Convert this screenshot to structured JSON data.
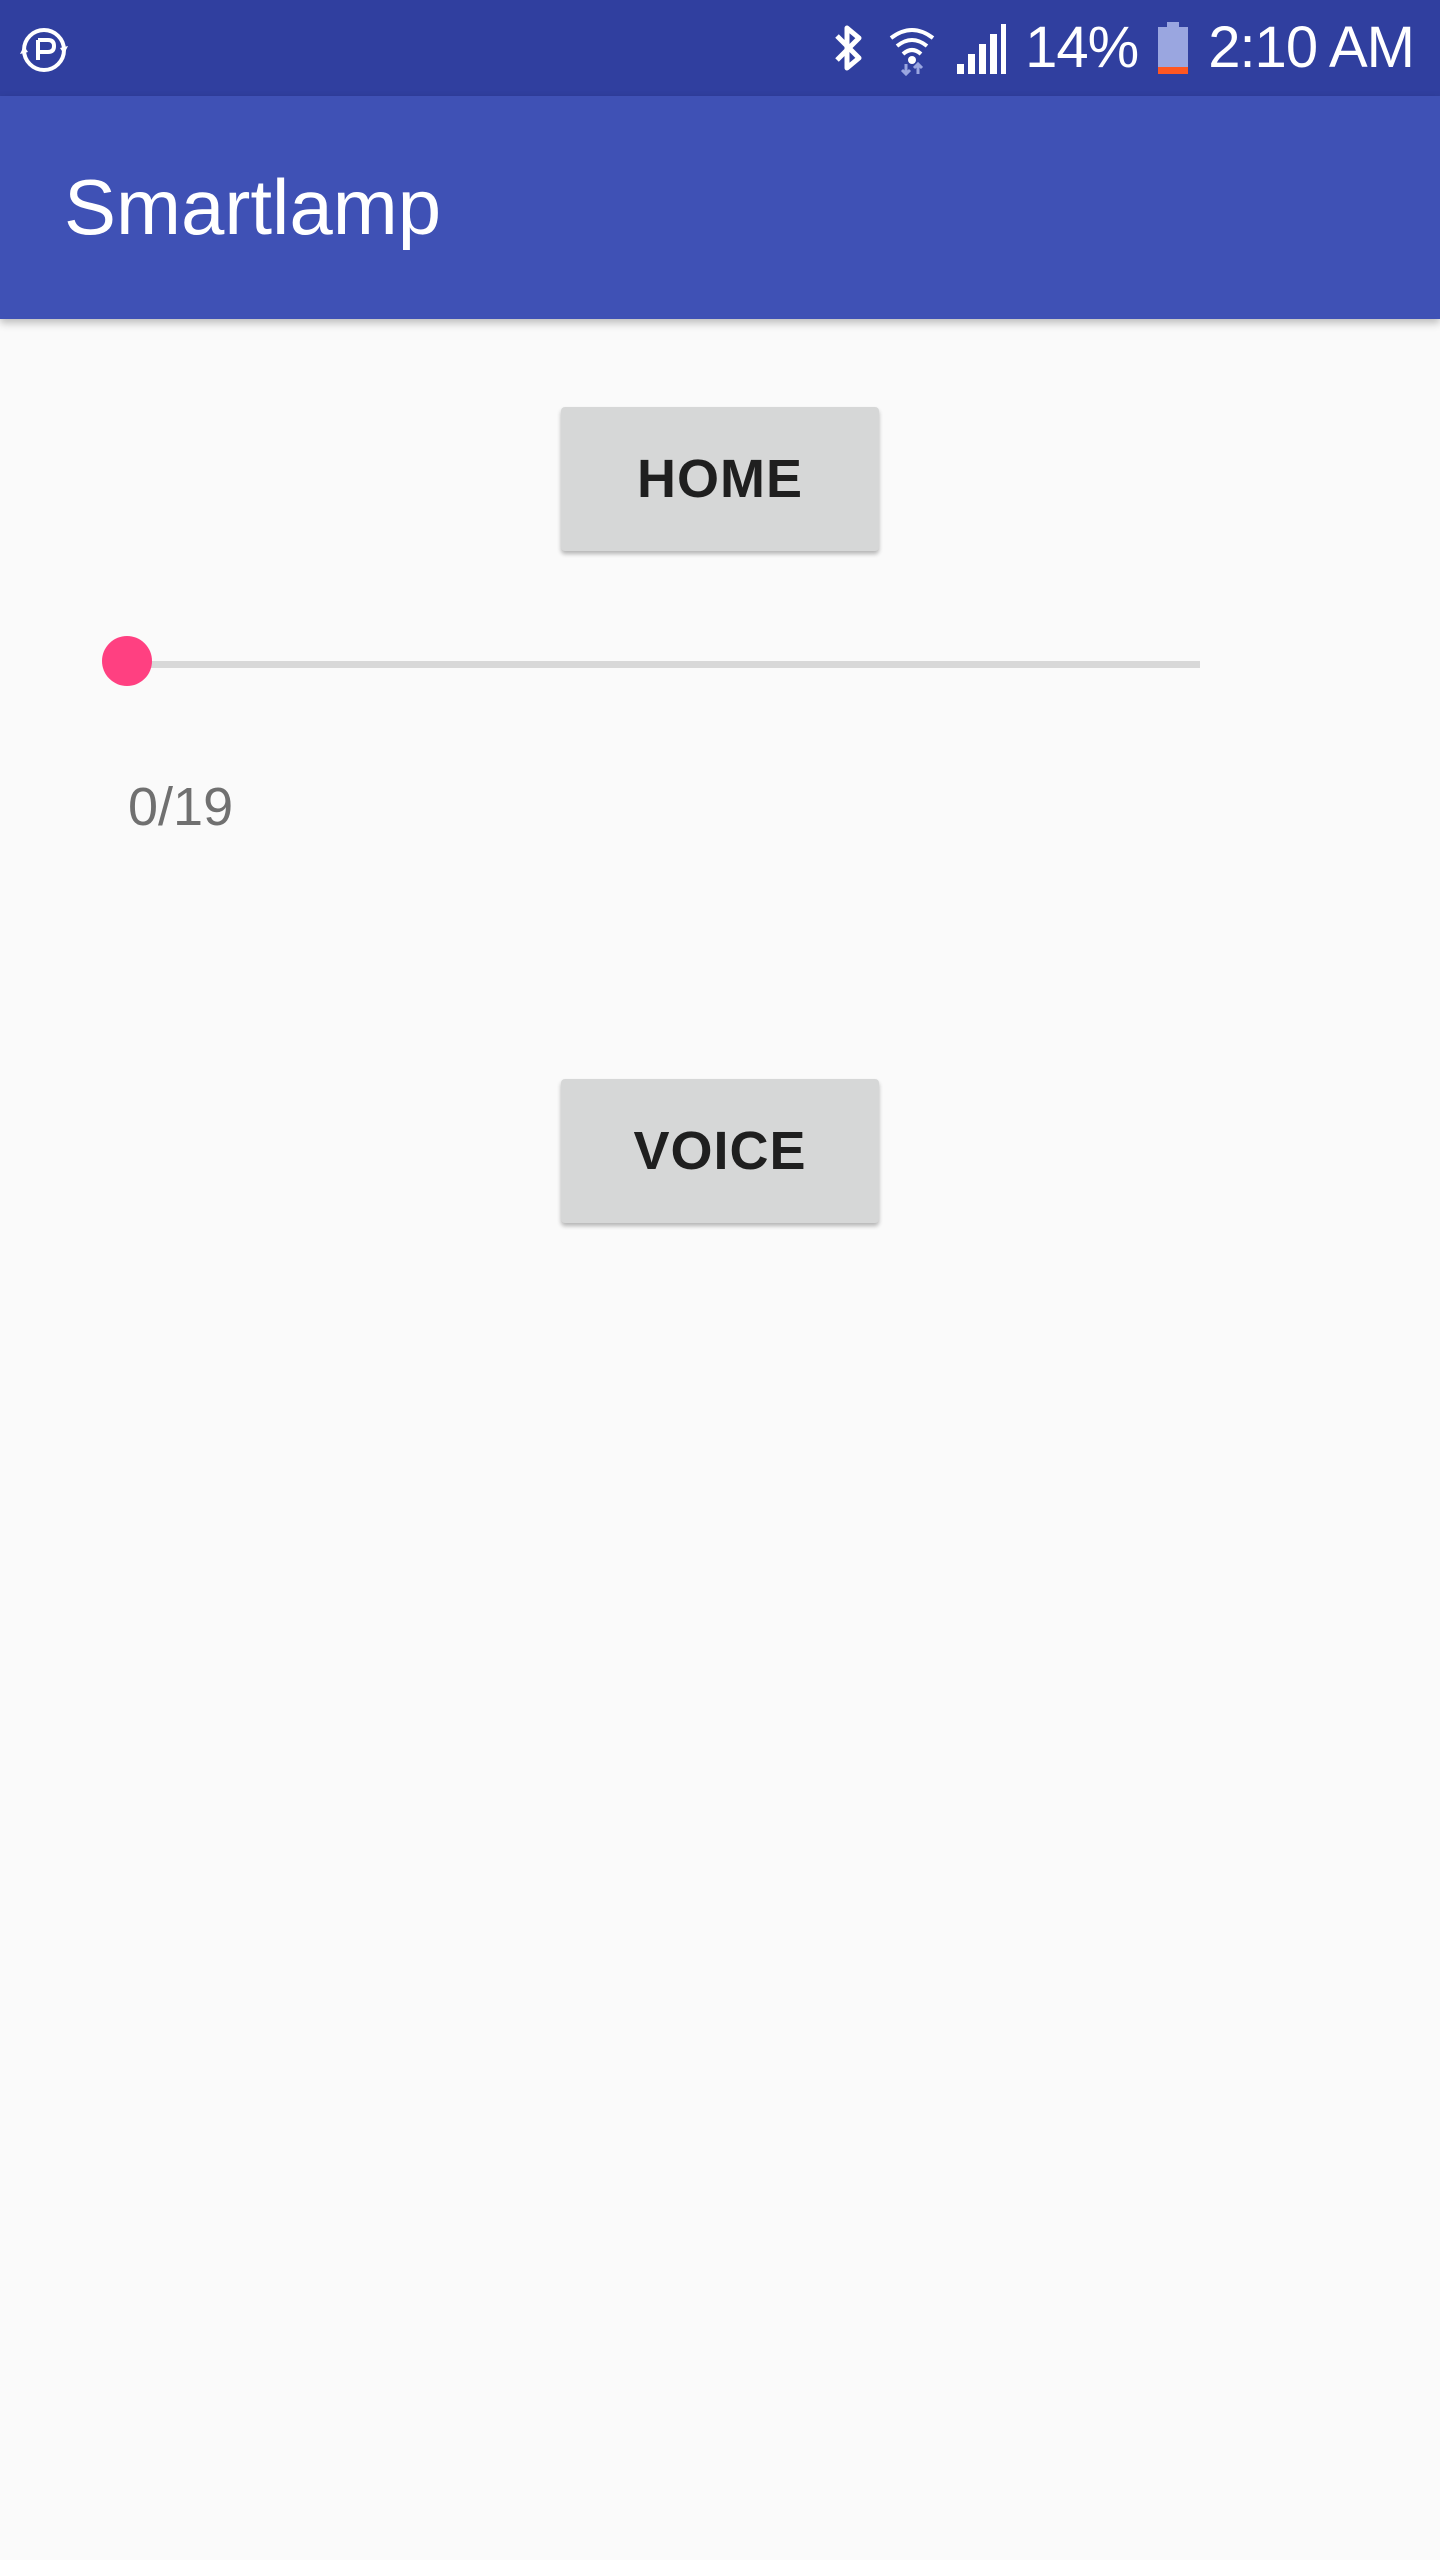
{
  "status_bar": {
    "battery_percent": "14%",
    "time": "2:10 AM",
    "battery_level": 0.14,
    "icons": [
      "sync-icon",
      "bluetooth-icon",
      "wifi-icon",
      "signal-icon",
      "battery-icon"
    ]
  },
  "app_bar": {
    "title": "Smartlamp"
  },
  "main": {
    "home_button_label": "HOME",
    "voice_button_label": "VOICE",
    "slider": {
      "value": 0,
      "max": 19
    },
    "progress_text": "0/19"
  },
  "colors": {
    "status_bar": "#303f9f",
    "app_bar": "#3f51b5",
    "accent": "#ff4081",
    "background": "#fafafa",
    "button": "#d6d7d7"
  }
}
